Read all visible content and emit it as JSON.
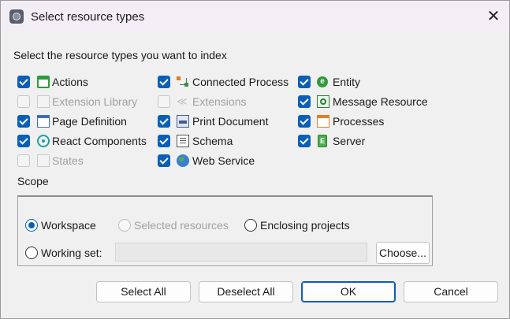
{
  "window": {
    "title": "Select resource types",
    "close_icon": "close-icon"
  },
  "instruction": "Select the resource types you want to index",
  "resource_types": [
    {
      "label": "Actions",
      "checked": true,
      "enabled": true,
      "icon": "actions-icon"
    },
    {
      "label": "Extension Library",
      "checked": false,
      "enabled": false,
      "icon": "extension-library-icon"
    },
    {
      "label": "Page Definition",
      "checked": true,
      "enabled": true,
      "icon": "page-definition-icon"
    },
    {
      "label": "React Components",
      "checked": true,
      "enabled": true,
      "icon": "react-components-icon"
    },
    {
      "label": "States",
      "checked": false,
      "enabled": false,
      "icon": "states-icon"
    },
    {
      "label": "Connected Process",
      "checked": true,
      "enabled": true,
      "icon": "connected-process-icon"
    },
    {
      "label": "Extensions",
      "checked": false,
      "enabled": false,
      "icon": "extensions-icon"
    },
    {
      "label": "Print Document",
      "checked": true,
      "enabled": true,
      "icon": "print-document-icon"
    },
    {
      "label": "Schema",
      "checked": true,
      "enabled": true,
      "icon": "schema-icon"
    },
    {
      "label": "Web Service",
      "checked": true,
      "enabled": true,
      "icon": "web-service-icon"
    },
    {
      "label": "Entity",
      "checked": true,
      "enabled": true,
      "icon": "entity-icon"
    },
    {
      "label": "Message Resource",
      "checked": true,
      "enabled": true,
      "icon": "message-resource-icon"
    },
    {
      "label": "Processes",
      "checked": true,
      "enabled": true,
      "icon": "processes-icon"
    },
    {
      "label": "Server",
      "checked": true,
      "enabled": true,
      "icon": "server-icon"
    }
  ],
  "scope": {
    "label": "Scope",
    "options": {
      "workspace": {
        "label": "Workspace",
        "selected": true,
        "enabled": true
      },
      "selected_resources": {
        "label": "Selected resources",
        "selected": false,
        "enabled": false
      },
      "enclosing_projects": {
        "label": "Enclosing projects",
        "selected": false,
        "enabled": true
      },
      "working_set": {
        "label": "Working set:",
        "selected": false,
        "enabled": true
      }
    },
    "working_set_value": "",
    "choose_label": "Choose..."
  },
  "buttons": {
    "select_all": "Select All",
    "deselect_all": "Deselect All",
    "ok": "OK",
    "cancel": "Cancel"
  },
  "colors": {
    "accent": "#0a5fb8",
    "titlebar": "#f3eef6",
    "background": "#f0f0f0"
  }
}
